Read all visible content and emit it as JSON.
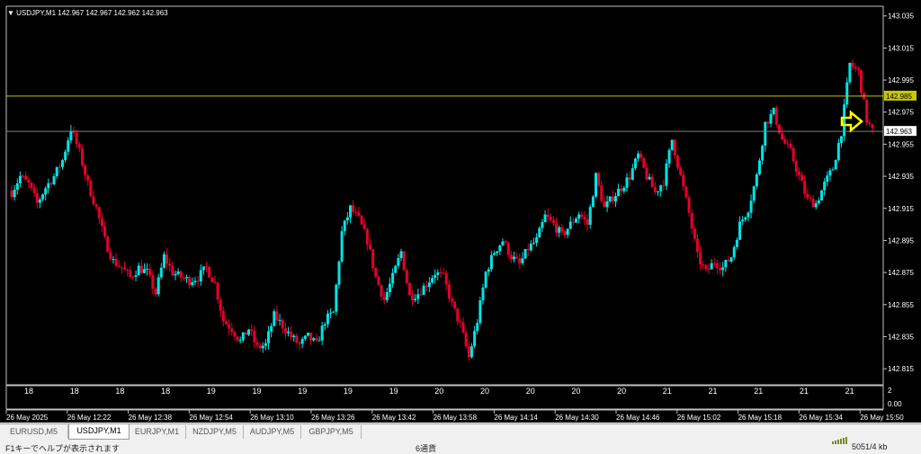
{
  "window": {
    "symbol_info": "USDJPY,M1  142.967 142.967 142.962 142.963",
    "info_arrow": "▼"
  },
  "colors": {
    "background": "#000000",
    "bull": "#00e5e5",
    "bear": "#e6002a",
    "axis_text": "#ffffff",
    "yellow_line": "#c8c800",
    "price_line": "#808080",
    "arrow": "#ffff00"
  },
  "chart_data": {
    "type": "candlestick",
    "symbol": "USDJPY",
    "timeframe": "M1",
    "ylim": [
      142.805,
      143.041
    ],
    "y_ticks": [
      142.815,
      142.835,
      142.855,
      142.875,
      142.895,
      142.915,
      142.935,
      142.955,
      142.975,
      142.995,
      143.015,
      143.035
    ],
    "hline_yellow": 142.985,
    "bid_line": 142.963,
    "bid_label": "142.963",
    "yellow_label": "142.985",
    "hour_labels": [
      "18",
      "18",
      "18",
      "18",
      "19",
      "19",
      "19",
      "19",
      "19",
      "20",
      "20",
      "20",
      "20",
      "20",
      "21",
      "21",
      "21",
      "21",
      "21"
    ],
    "sub_axis_top": "2",
    "sub_axis_zero": "0.00",
    "time_labels": [
      "26 May 2025",
      "26 May 12:22",
      "26 May 12:38",
      "26 May 12:54",
      "26 May 13:10",
      "26 May 13:26",
      "26 May 13:42",
      "26 May 13:58",
      "26 May 14:14",
      "26 May 14:30",
      "26 May 14:46",
      "26 May 15:02",
      "26 May 15:18",
      "26 May 15:34",
      "26 May 15:50"
    ],
    "close_path": [
      [
        0,
        142.925
      ],
      [
        3,
        142.935
      ],
      [
        6,
        142.93
      ],
      [
        9,
        142.918
      ],
      [
        12,
        142.928
      ],
      [
        15,
        142.935
      ],
      [
        18,
        142.945
      ],
      [
        21,
        142.965
      ],
      [
        24,
        142.95
      ],
      [
        27,
        142.93
      ],
      [
        30,
        142.915
      ],
      [
        33,
        142.895
      ],
      [
        36,
        142.882
      ],
      [
        39,
        142.878
      ],
      [
        42,
        142.872
      ],
      [
        45,
        142.878
      ],
      [
        48,
        142.875
      ],
      [
        51,
        142.862
      ],
      [
        54,
        142.885
      ],
      [
        57,
        142.875
      ],
      [
        60,
        142.872
      ],
      [
        63,
        142.87
      ],
      [
        66,
        142.872
      ],
      [
        69,
        142.878
      ],
      [
        72,
        142.868
      ],
      [
        75,
        142.845
      ],
      [
        78,
        142.84
      ],
      [
        81,
        142.832
      ],
      [
        84,
        142.84
      ],
      [
        87,
        142.828
      ],
      [
        90,
        142.83
      ],
      [
        93,
        142.848
      ],
      [
        96,
        142.842
      ],
      [
        99,
        142.835
      ],
      [
        102,
        142.83
      ],
      [
        105,
        142.835
      ],
      [
        108,
        142.83
      ],
      [
        111,
        142.845
      ],
      [
        114,
        142.85
      ],
      [
        117,
        142.9
      ],
      [
        120,
        142.915
      ],
      [
        123,
        142.908
      ],
      [
        126,
        142.895
      ],
      [
        129,
        142.872
      ],
      [
        132,
        142.858
      ],
      [
        135,
        142.872
      ],
      [
        138,
        142.888
      ],
      [
        141,
        142.86
      ],
      [
        144,
        142.862
      ],
      [
        147,
        142.868
      ],
      [
        150,
        142.875
      ],
      [
        153,
        142.872
      ],
      [
        156,
        142.855
      ],
      [
        159,
        142.842
      ],
      [
        162,
        142.822
      ],
      [
        165,
        142.845
      ],
      [
        168,
        142.875
      ],
      [
        171,
        142.888
      ],
      [
        174,
        142.895
      ],
      [
        177,
        142.885
      ],
      [
        180,
        142.88
      ],
      [
        183,
        142.89
      ],
      [
        186,
        142.895
      ],
      [
        189,
        142.91
      ],
      [
        192,
        142.905
      ],
      [
        195,
        142.898
      ],
      [
        198,
        142.905
      ],
      [
        201,
        142.912
      ],
      [
        204,
        142.905
      ],
      [
        207,
        142.935
      ],
      [
        210,
        142.915
      ],
      [
        213,
        142.922
      ],
      [
        216,
        142.928
      ],
      [
        219,
        142.935
      ],
      [
        222,
        142.948
      ],
      [
        225,
        142.935
      ],
      [
        228,
        142.925
      ],
      [
        231,
        142.932
      ],
      [
        234,
        142.958
      ],
      [
        237,
        142.935
      ],
      [
        240,
        142.912
      ],
      [
        243,
        142.885
      ],
      [
        246,
        142.875
      ],
      [
        249,
        142.882
      ],
      [
        252,
        142.878
      ],
      [
        255,
        142.885
      ],
      [
        258,
        142.905
      ],
      [
        261,
        142.915
      ],
      [
        264,
        142.935
      ],
      [
        267,
        142.968
      ],
      [
        270,
        142.975
      ],
      [
        273,
        142.958
      ],
      [
        276,
        142.95
      ],
      [
        279,
        142.935
      ],
      [
        282,
        142.92
      ],
      [
        285,
        142.918
      ],
      [
        288,
        142.93
      ],
      [
        291,
        142.94
      ],
      [
        294,
        142.963
      ],
      [
        297,
        143.005
      ],
      [
        300,
        143.0
      ],
      [
        303,
        142.97
      ],
      [
        305,
        142.963
      ]
    ]
  },
  "tabs": [
    "EURUSD,M5",
    "USDJPY,M1",
    "EURJPY,M1",
    "NZDJPY,M5",
    "AUDJPY,M5",
    "GBPJPY,M5"
  ],
  "active_tab": 1,
  "status": {
    "help": "F1キーでヘルプが表示されます",
    "profile": "6通貨",
    "traffic": "5051/4 kb"
  }
}
